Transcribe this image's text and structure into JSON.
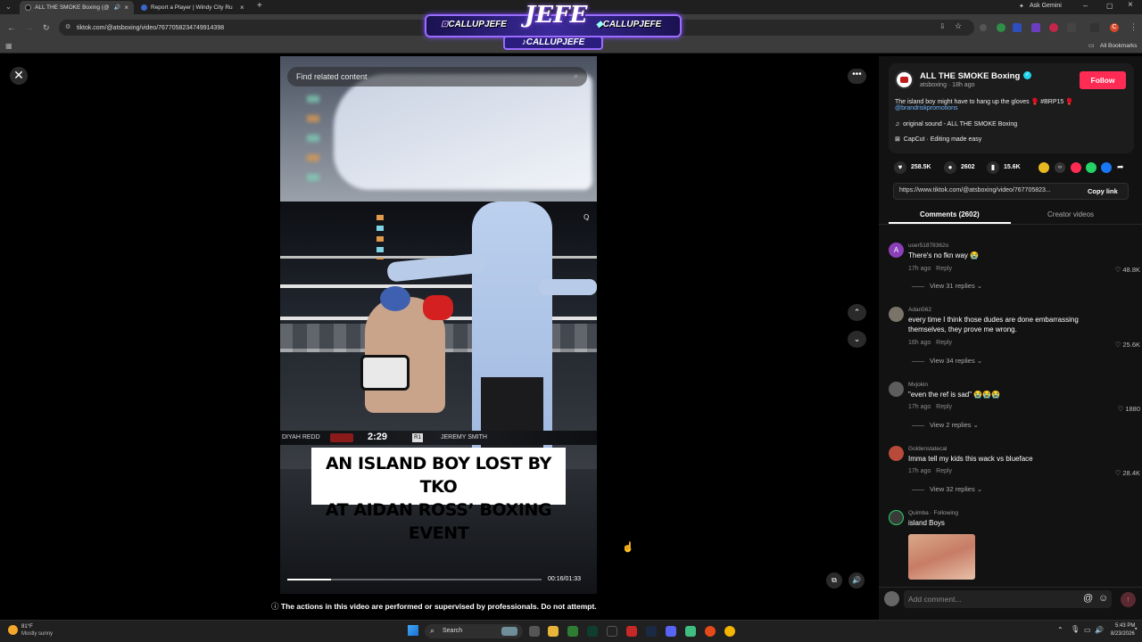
{
  "browser": {
    "tabs": [
      {
        "title": "ALL THE SMOKE Boxing (@"
      },
      {
        "title": "Report a Player | Windy City Ru"
      }
    ],
    "url": "tiktok.com/@atsboxing/video/7677058234749914398",
    "ask_gemini": "Ask Gemini",
    "all_bookmarks": "All Bookmarks",
    "profile_initial": "C"
  },
  "stream_overlay": {
    "brand": "JEFE",
    "handle_left": "CALLUPJEFE",
    "handle_right": "CALLUPJEFE",
    "handle_bottom": "CALLUPJEFE"
  },
  "video": {
    "search_placeholder": "Find related content",
    "scoreboard": {
      "left_name": "DIYAH REDD",
      "clock": "2:29",
      "round": "R1",
      "right_name": "JEREMY SMITH"
    },
    "caption_line1": "AN ISLAND BOY LOST BY TKO",
    "caption_line2": "AT AIDAN ROSS’ BOXING EVENT",
    "time": "00:16/01:33",
    "progress_fraction": 0.172,
    "disclaimer": "The actions in this video are performed or supervised by professionals. Do not attempt."
  },
  "creator": {
    "name": "ALL THE SMOKE Boxing",
    "subtitle": "atsboxing · 18h ago",
    "follow_label": "Follow",
    "description": "The island boy might have to hang up the gloves 🥊 #BRP15 🥊",
    "mention": "@brandriskpromotions",
    "sound": "original sound - ALL THE SMOKE Boxing",
    "capcut": "CapCut · Editing made easy"
  },
  "stats": {
    "likes": "258.5K",
    "comments": "2602",
    "saves": "15.6K"
  },
  "share": {
    "link": "https://www.tiktok.com/@atsboxing/video/767705823...",
    "copy_label": "Copy link"
  },
  "tabs": {
    "comments": "Comments (2602)",
    "creator_videos": "Creator videos"
  },
  "comments": [
    {
      "user": "user51878362o",
      "text": "There's no fkn way 😭",
      "meta": "17h ago",
      "reply": "Reply",
      "likes": "48.8K",
      "replies": "View 31 replies"
    },
    {
      "user": "Adan562",
      "text": "every time I think those dudes are done embarrassing themselves, they prove me wrong.",
      "meta": "16h ago",
      "reply": "Reply",
      "likes": "25.6K",
      "replies": "View 34 replies"
    },
    {
      "user": "Mvjokin",
      "text": "\"even the ref is sad\" 😭😭😭",
      "meta": "17h ago",
      "reply": "Reply",
      "likes": "1880",
      "replies": "View 2 replies"
    },
    {
      "user": "Goldenstatecal",
      "text": "Imma tell my kids this wack vs blueface",
      "meta": "17h ago",
      "reply": "Reply",
      "likes": "28.4K",
      "replies": "View 32 replies"
    },
    {
      "user": "Quimba · Following",
      "text": "island Boys"
    }
  ],
  "add_comment_placeholder": "Add comment...",
  "taskbar": {
    "weather_temp": "81°F",
    "weather_desc": "Mostly sunny",
    "search": "Search",
    "time": "5:43 PM",
    "date": "8/23/2026"
  },
  "colors": {
    "follow": "#fe2c55",
    "link": "#6fb6ff",
    "accent_border": "#9b6cff"
  }
}
